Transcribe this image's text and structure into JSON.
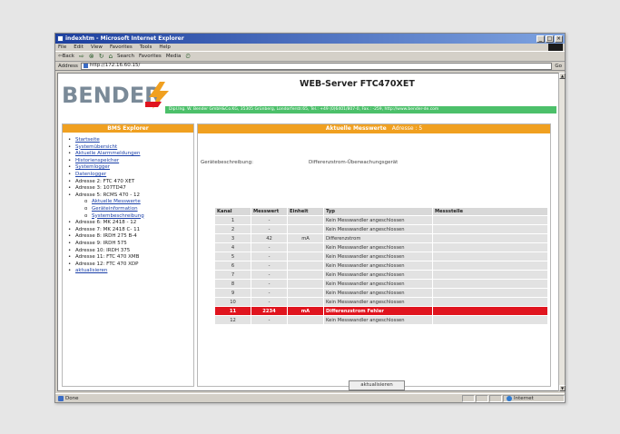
{
  "window": {
    "title": "indexhtm - Microsoft Internet Explorer",
    "min": "_",
    "max": "□",
    "close": "×"
  },
  "menu": [
    "File",
    "Edit",
    "View",
    "Favorites",
    "Tools",
    "Help"
  ],
  "toolbar": {
    "back": "⇦Back",
    "forward": "⇨",
    "stop": "⊗",
    "refresh": "↻",
    "home": "⌂",
    "search": "Search",
    "favorites": "Favorites",
    "media": "Media",
    "history": "⏲"
  },
  "address": {
    "label": "Address",
    "url": "http://172.16.60.15/",
    "go": "Go"
  },
  "header": {
    "logo": "BENDER",
    "title": "WEB-Server FTC470XET",
    "contact": "Dipl.Ing. W. Bender GmbH&Co.KG, 35305 Grünberg, Londorferstr.65, Tel.: +49 (0)6401/807-0, Fax.: -259, http://www.bender-de.com"
  },
  "explorer": {
    "title": "BMS Explorer",
    "items": [
      {
        "text": "Startseite",
        "link": true,
        "sub": false
      },
      {
        "text": "Systemübersicht",
        "link": true,
        "sub": false
      },
      {
        "text": "Aktuelle Alarmmeldungen",
        "link": true,
        "sub": false
      },
      {
        "text": "Historienspeicher",
        "link": true,
        "sub": false
      },
      {
        "text": "Systemlogger",
        "link": true,
        "sub": false
      },
      {
        "text": "Datenlogger",
        "link": true,
        "sub": false
      },
      {
        "text": "Adresse  2:   FTC 470 XET",
        "link": false,
        "sub": false
      },
      {
        "text": "Adresse  3:   107TD47",
        "link": false,
        "sub": false
      },
      {
        "text": "Adresse  5:   RCMS 470 - 12",
        "link": false,
        "sub": false
      },
      {
        "text": "Aktuelle Messwerte",
        "link": true,
        "sub": true
      },
      {
        "text": "Geräteinformation",
        "link": true,
        "sub": true
      },
      {
        "text": "Systembeschreibung",
        "link": true,
        "sub": true
      },
      {
        "text": "Adresse  6:   MK 2418 - 12",
        "link": false,
        "sub": false
      },
      {
        "text": "Adresse  7:   MK 2418 C- 11",
        "link": false,
        "sub": false
      },
      {
        "text": "Adresse  8:   IRDH 275 B-4",
        "link": false,
        "sub": false
      },
      {
        "text": "Adresse  9:   IRDH 575",
        "link": false,
        "sub": false
      },
      {
        "text": "Adresse  10:  IRDH 375",
        "link": false,
        "sub": false
      },
      {
        "text": "Adresse  11:  FTC 470 XMB",
        "link": false,
        "sub": false
      },
      {
        "text": "Adresse  12:  FTC 470 XDP",
        "link": false,
        "sub": false
      },
      {
        "text": "aktualisieren",
        "link": true,
        "sub": false
      }
    ]
  },
  "main": {
    "title": "Aktuelle Messwerte",
    "address": "Adresse : 5",
    "device_label": "Gerätebeschreibung:",
    "device_value": "Differenzstrom-Überwachungsgerät",
    "columns": [
      "Kanal",
      "Messwert",
      "Einheit",
      "Typ",
      "Messstelle"
    ],
    "rows": [
      {
        "kanal": "1",
        "wert": "-",
        "einheit": "",
        "typ": "Kein Messwandler angeschlossen",
        "stelle": "",
        "alarm": false
      },
      {
        "kanal": "2",
        "wert": "-",
        "einheit": "",
        "typ": "Kein Messwandler angeschlossen",
        "stelle": "",
        "alarm": false
      },
      {
        "kanal": "3",
        "wert": "42",
        "einheit": "mA",
        "typ": "Differenzstrom",
        "stelle": "",
        "alarm": false
      },
      {
        "kanal": "4",
        "wert": "-",
        "einheit": "",
        "typ": "Kein Messwandler angeschlossen",
        "stelle": "",
        "alarm": false
      },
      {
        "kanal": "5",
        "wert": "-",
        "einheit": "",
        "typ": "Kein Messwandler angeschlossen",
        "stelle": "",
        "alarm": false
      },
      {
        "kanal": "6",
        "wert": "-",
        "einheit": "",
        "typ": "Kein Messwandler angeschlossen",
        "stelle": "",
        "alarm": false
      },
      {
        "kanal": "7",
        "wert": "-",
        "einheit": "",
        "typ": "Kein Messwandler angeschlossen",
        "stelle": "",
        "alarm": false
      },
      {
        "kanal": "8",
        "wert": "-",
        "einheit": "",
        "typ": "Kein Messwandler angeschlossen",
        "stelle": "",
        "alarm": false
      },
      {
        "kanal": "9",
        "wert": "-",
        "einheit": "",
        "typ": "Kein Messwandler angeschlossen",
        "stelle": "",
        "alarm": false
      },
      {
        "kanal": "10",
        "wert": "-",
        "einheit": "",
        "typ": "Kein Messwandler angeschlossen",
        "stelle": "",
        "alarm": false
      },
      {
        "kanal": "11",
        "wert": "2234",
        "einheit": "mA",
        "typ": "Differenzstrom Fehler",
        "stelle": "",
        "alarm": true
      },
      {
        "kanal": "12",
        "wert": "-",
        "einheit": "",
        "typ": "Kein Messwandler angeschlossen",
        "stelle": "",
        "alarm": false
      }
    ],
    "refresh_label": "aktualisieren"
  },
  "status": {
    "left": "Done",
    "zone": "Internet"
  },
  "colors": {
    "accent": "#f0a020",
    "alarm": "#e0141e",
    "brand_green": "#4cc06a"
  }
}
